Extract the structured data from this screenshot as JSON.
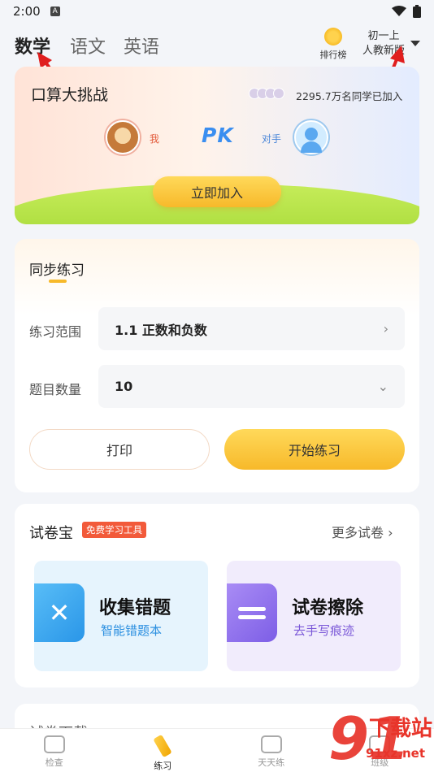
{
  "status_bar": {
    "time": "2:00",
    "sim_label": "A"
  },
  "top_nav": {
    "subjects": [
      "数学",
      "语文",
      "英语"
    ],
    "rank_label": "排行榜",
    "grade_line1": "初一上",
    "grade_line2": "人教新版"
  },
  "challenge": {
    "title": "口算大挑战",
    "joined_text": "2295.7万名同学已加入",
    "me_label": "我",
    "opponent_label": "对手",
    "pk_label": "PK",
    "join_button": "立即加入"
  },
  "sync_practice": {
    "title": "同步练习",
    "range_label": "练习范围",
    "range_value": "1.1 正数和负数",
    "count_label": "题目数量",
    "count_value": "10",
    "print_button": "打印",
    "start_button": "开始练习"
  },
  "paper_treasure": {
    "title": "试卷宝",
    "badge": "免费学习工具",
    "more": "更多试卷",
    "tools": [
      {
        "title": "收集错题",
        "subtitle": "智能错题本"
      },
      {
        "title": "试卷擦除",
        "subtitle": "去手写痕迹"
      }
    ]
  },
  "next_section_title": "试卷下载",
  "tabbar": {
    "items": [
      "检查",
      "练习",
      "天天练",
      "班级"
    ]
  },
  "watermark": {
    "big": "91",
    "text": "下载站",
    "url": "91xz.net"
  },
  "colors": {
    "accent": "#f7b92a",
    "red": "#e8342a",
    "blue": "#3a8ef0"
  }
}
